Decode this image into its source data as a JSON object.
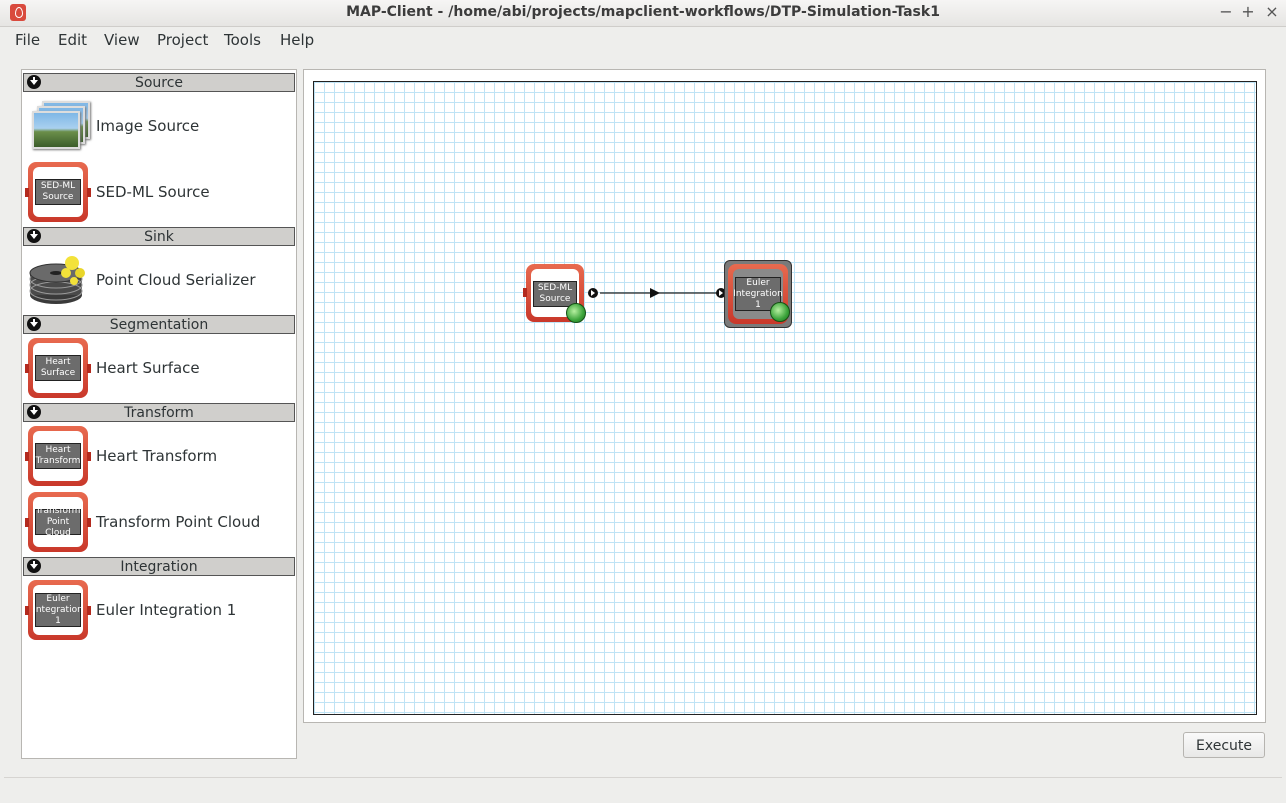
{
  "window": {
    "title": "MAP-Client - /home/abi/projects/mapclient-workflows/DTP-Simulation-Task1",
    "controls": [
      "−",
      "+",
      "×"
    ]
  },
  "menu": [
    "File",
    "Edit",
    "View",
    "Project",
    "Tools",
    "Help"
  ],
  "palette": {
    "categories": [
      {
        "label": "Source",
        "items": [
          {
            "label": "Image Source",
            "icon": "image-stack-icon"
          },
          {
            "label": "SED-ML Source",
            "icon_text": "SED-ML Source"
          }
        ]
      },
      {
        "label": "Sink",
        "items": [
          {
            "label": "Point Cloud Serializer",
            "icon": "disk-icon"
          }
        ]
      },
      {
        "label": "Segmentation",
        "items": [
          {
            "label": "Heart Surface",
            "icon_text": "Heart Surface"
          }
        ]
      },
      {
        "label": "Transform",
        "items": [
          {
            "label": "Heart Transform",
            "icon_text": "Heart Transform"
          },
          {
            "label": "Transform Point Cloud",
            "icon_text": "Transform Point Cloud"
          }
        ]
      },
      {
        "label": "Integration",
        "items": [
          {
            "label": "Euler Integration 1",
            "icon_text": "Euler Integration 1"
          }
        ]
      }
    ]
  },
  "workflow": {
    "nodes": [
      {
        "id": "sedml",
        "text": "SED-ML Source",
        "selected": false
      },
      {
        "id": "euler",
        "text": "Euler Integration 1",
        "selected": true
      }
    ],
    "connections": [
      {
        "from": "sedml",
        "to": "euler"
      }
    ]
  },
  "buttons": {
    "execute": "Execute"
  },
  "colors": {
    "step_red": "#d94a3d",
    "grid": "#bfe3f5",
    "status_green": "#3aa33a"
  }
}
